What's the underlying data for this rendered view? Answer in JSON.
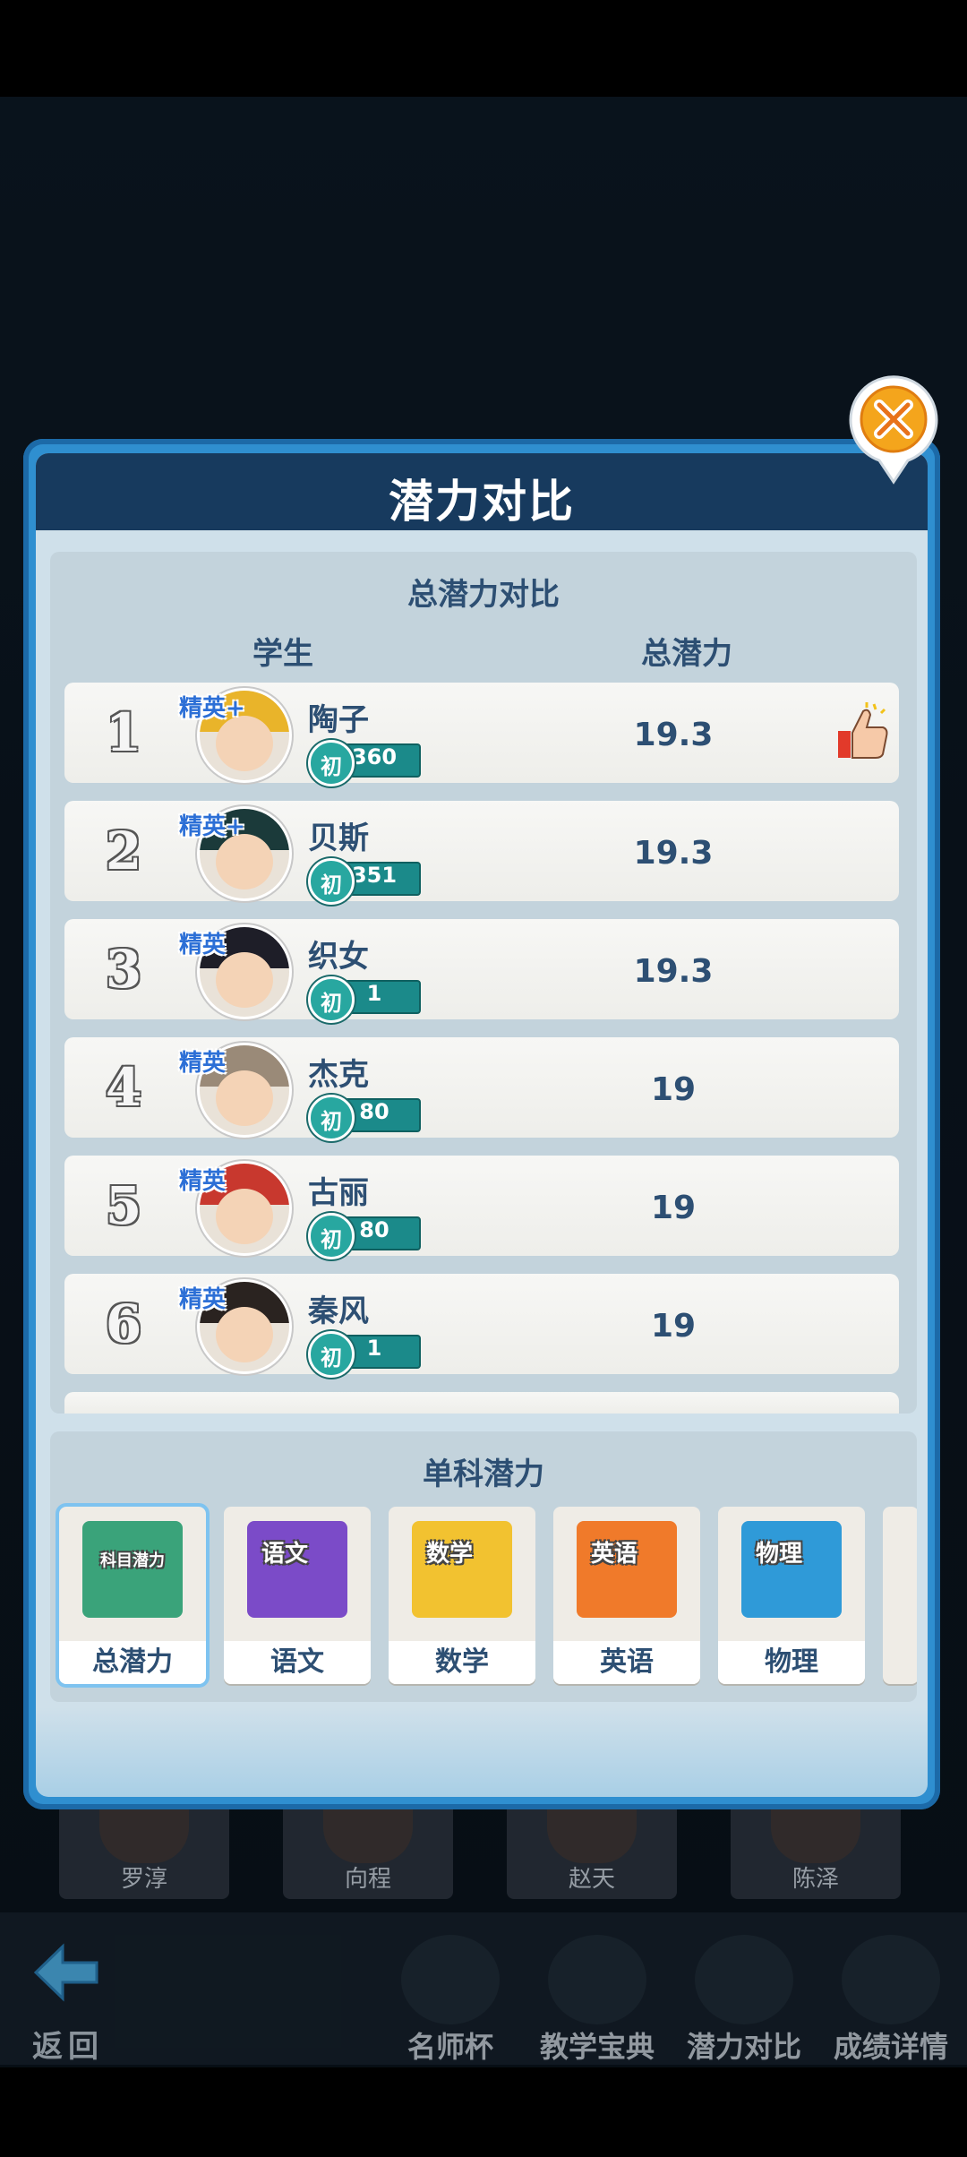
{
  "panel": {
    "title": "潜力对比"
  },
  "total": {
    "section_title": "总潜力对比",
    "col_student": "学生",
    "col_potential": "总潜力",
    "rows": [
      {
        "rank": "1",
        "name": "陶子",
        "elite": "精英+",
        "level_tag": "初",
        "level": "360",
        "score": "19.3",
        "thumb": true
      },
      {
        "rank": "2",
        "name": "贝斯",
        "elite": "精英+",
        "level_tag": "初",
        "level": "351",
        "score": "19.3"
      },
      {
        "rank": "3",
        "name": "织女",
        "elite": "精英",
        "level_tag": "初",
        "level": "1",
        "score": "19.3"
      },
      {
        "rank": "4",
        "name": "杰克",
        "elite": "精英",
        "level_tag": "初",
        "level": "80",
        "score": "19"
      },
      {
        "rank": "5",
        "name": "古丽",
        "elite": "精英",
        "level_tag": "初",
        "level": "80",
        "score": "19"
      },
      {
        "rank": "6",
        "name": "秦风",
        "elite": "精英",
        "level_tag": "初",
        "level": "1",
        "score": "19"
      }
    ]
  },
  "subjects": {
    "section_title": "单科潜力",
    "items": [
      {
        "label": "总潜力",
        "book_text": "科目潜力",
        "color": "#3aa37a",
        "selected": true
      },
      {
        "label": "语文",
        "book_text": "语文",
        "color": "#7b4bc8"
      },
      {
        "label": "数学",
        "book_text": "数学",
        "color": "#f2c230"
      },
      {
        "label": "英语",
        "book_text": "英语",
        "color": "#f07a2a"
      },
      {
        "label": "物理",
        "book_text": "物理",
        "color": "#2f9ad8"
      }
    ]
  },
  "background": {
    "cards": [
      "罗淳",
      "向程",
      "赵天",
      "陈泽"
    ]
  },
  "bottombar": {
    "back": "返回",
    "tools": [
      "名师杯",
      "教学宝典",
      "潜力对比",
      "成绩详情"
    ]
  }
}
